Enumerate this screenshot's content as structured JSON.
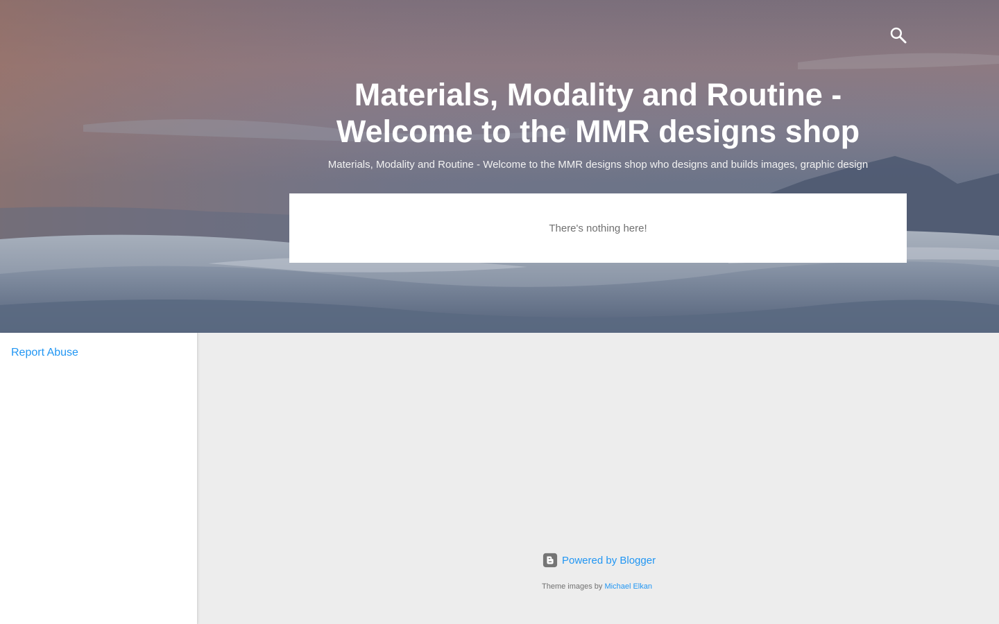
{
  "header": {
    "title": "Materials, Modality and Routine - Welcome to the MMR designs shop",
    "description": "Materials, Modality and Routine - Welcome to the MMR designs shop who designs and builds images, graphic design",
    "search_icon": "search-icon"
  },
  "main": {
    "empty_message": "There's nothing here!"
  },
  "sidebar": {
    "report_abuse_label": "Report Abuse"
  },
  "footer": {
    "powered_label": "Powered by Blogger",
    "blogger_icon": "blogger-icon",
    "theme_credit_prefix": "Theme images by",
    "theme_credit_author": "Michael Elkan"
  },
  "colors": {
    "accent": "#2196f3",
    "background": "#ededed",
    "card": "#ffffff",
    "muted_text": "#707070"
  }
}
